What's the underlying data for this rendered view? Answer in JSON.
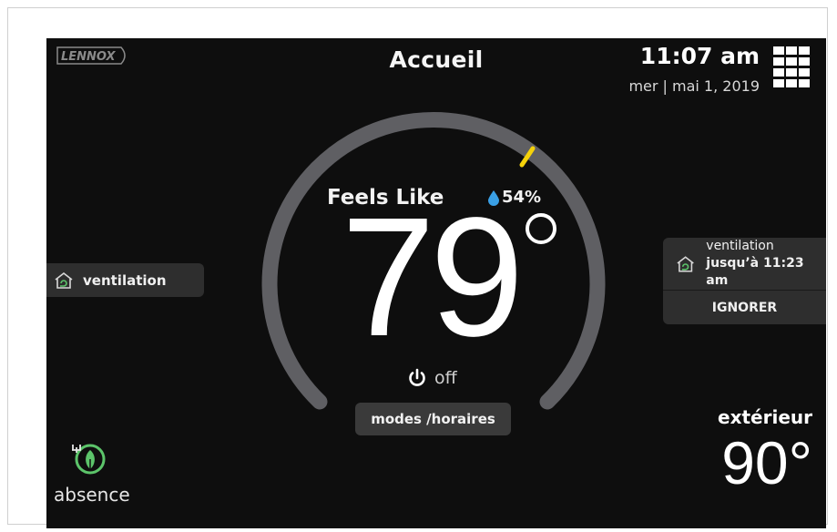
{
  "header": {
    "brand": "LENNOX",
    "title": "Accueil",
    "time": "11:07 am",
    "date": "mer | mai 1, 2019",
    "menu_icon": "grid-menu-icon"
  },
  "thermostat": {
    "feels_like_label": "Feels Like",
    "humidity": "54%",
    "humidity_icon": "water-drop-icon",
    "temperature": "79",
    "power_icon": "power-icon",
    "system_state": "off",
    "modes_button": "modes /horaires",
    "setpoint_marker_color": "#f5d20a",
    "arc_color": "#5f5f63"
  },
  "ventilation_left": {
    "label": "ventilation",
    "icon": "ventilation-house-icon"
  },
  "ventilation_right": {
    "line1": "ventilation",
    "line2": "jusqu’à 11:23 am",
    "ignore_button": "IGNORER",
    "icon": "ventilation-house-icon"
  },
  "outside": {
    "label": "extérieur",
    "temperature": "90°"
  },
  "away": {
    "label": "absence",
    "icon": "leaf-plug-icon",
    "color": "#5cc46a"
  }
}
